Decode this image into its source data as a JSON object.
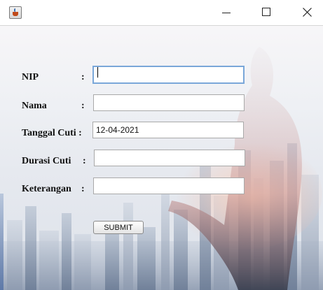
{
  "window": {
    "title": "",
    "icon": "java-cup-icon",
    "controls": [
      "minimize",
      "maximize",
      "close"
    ]
  },
  "form": {
    "fields": [
      {
        "label": "NIP",
        "colon": ":",
        "value": ""
      },
      {
        "label": "Nama",
        "colon": ":",
        "value": ""
      },
      {
        "label": "Tanggal Cuti :",
        "colon": "",
        "value": "12-04-2021"
      },
      {
        "label": "Durasi Cuti",
        "colon": ":",
        "value": ""
      },
      {
        "label": "Keterangan",
        "colon": ":",
        "value": ""
      }
    ],
    "submit_label": "SUBMIT"
  },
  "colors": {
    "focus_border": "#7aa7d9",
    "field_border": "#a9a9a9"
  }
}
